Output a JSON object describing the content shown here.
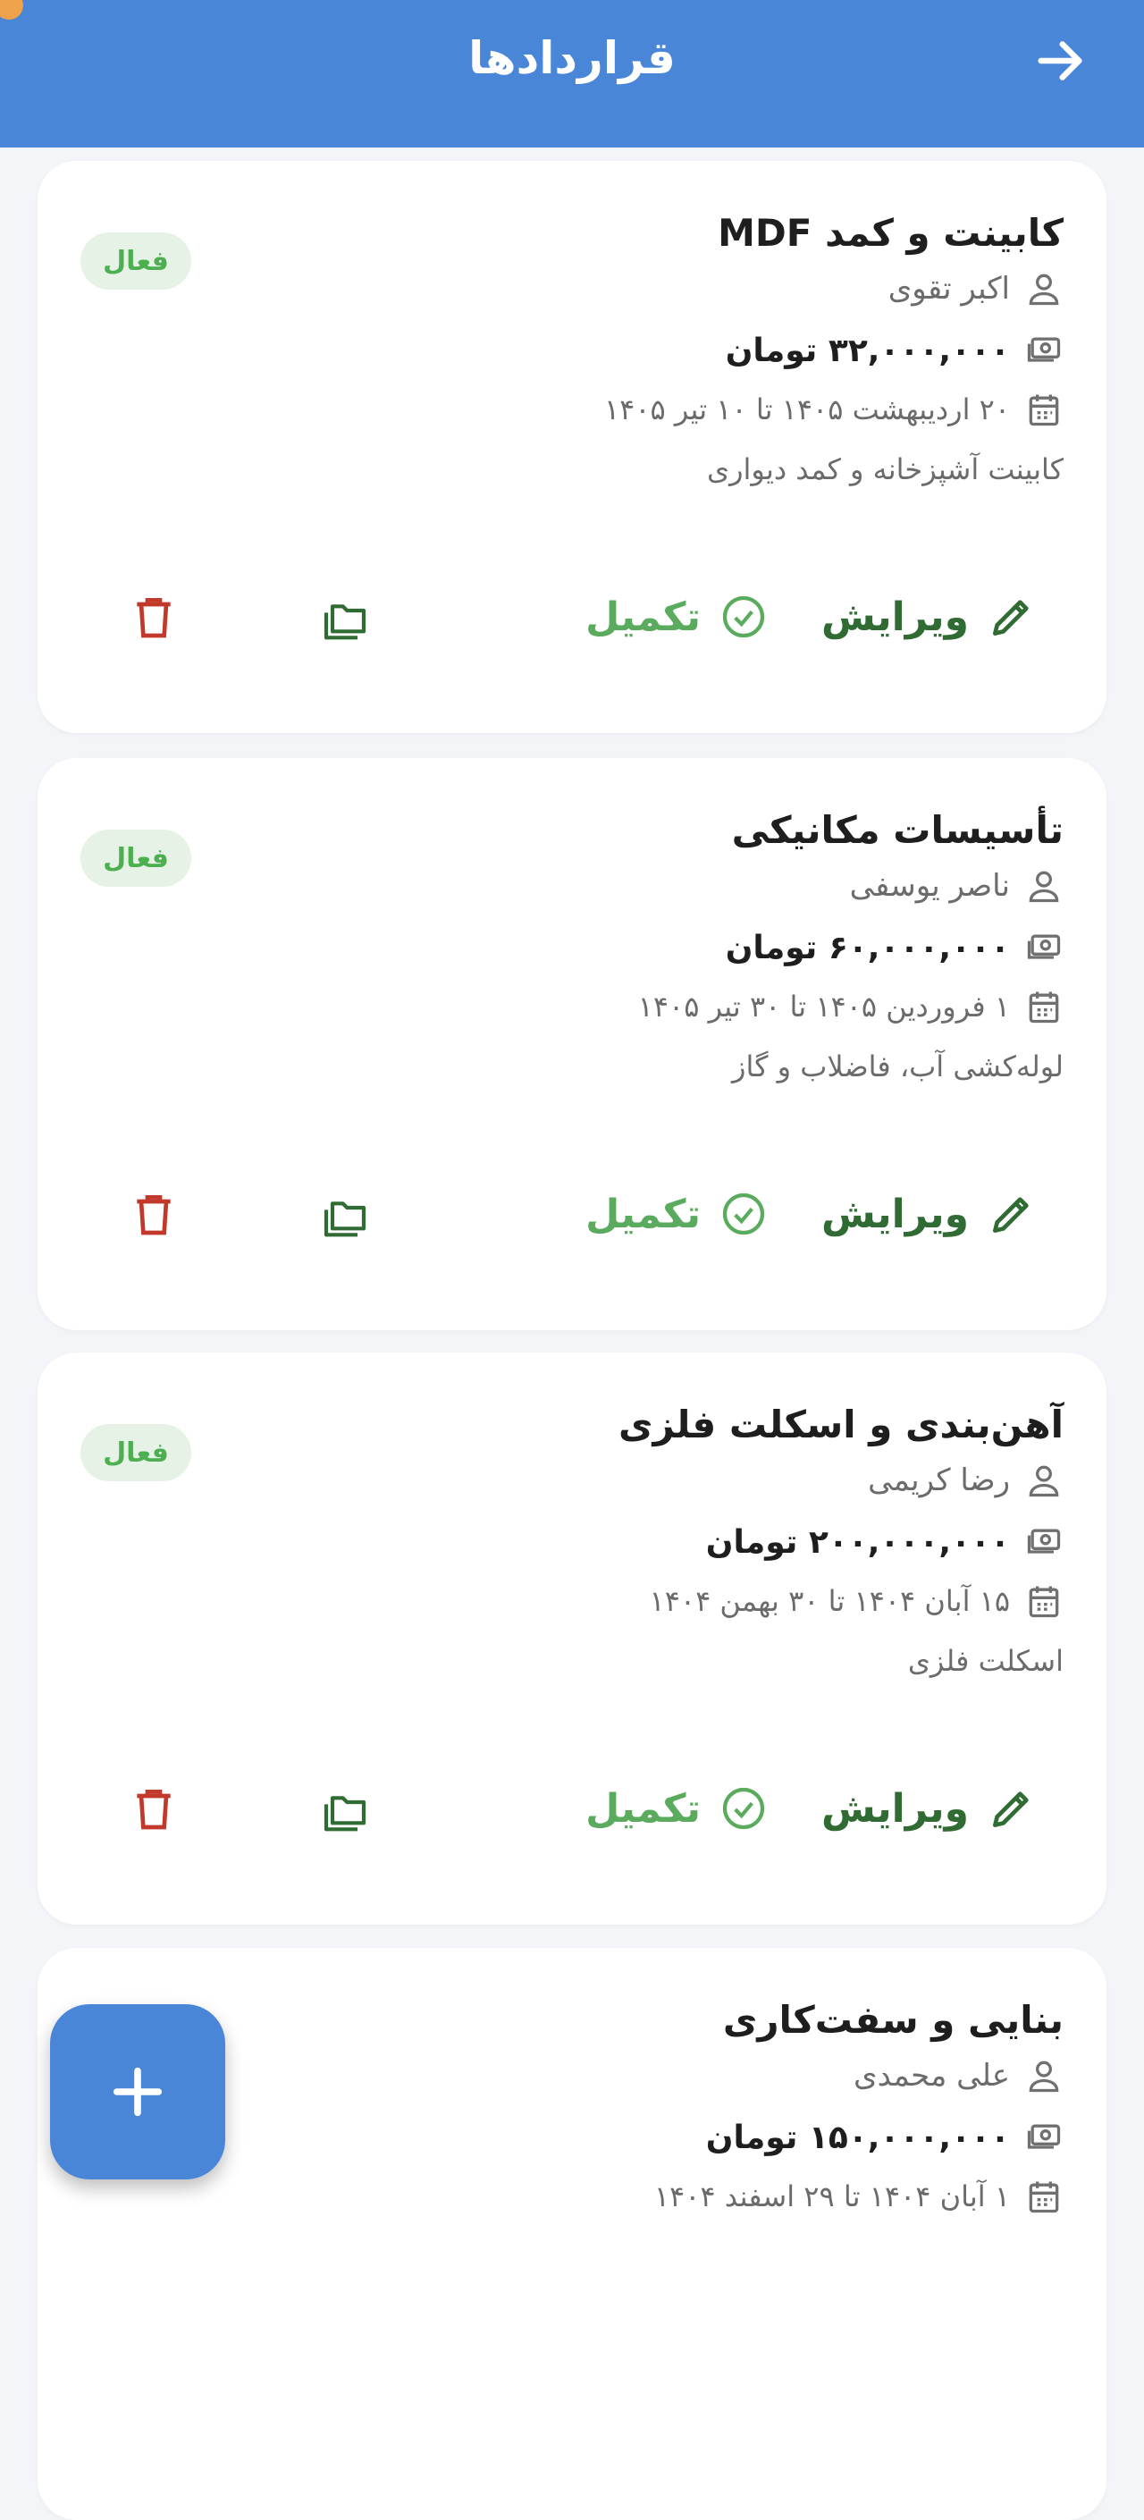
{
  "appbar": {
    "title": "قراردادها",
    "back_icon": "arrow-right-icon",
    "color": "#4a86d8"
  },
  "colors": {
    "status_active": "#4caf50",
    "edit": "#2f6b33",
    "complete": "#5aab5e",
    "delete": "#c0392b"
  },
  "contracts": [
    {
      "title": "کابینت و کمد MDF",
      "contractor": "اکبر تقوی",
      "amount": "۳۲,۰۰۰,۰۰۰ تومان",
      "dates": "۲۰ اردیبهشت ۱۴۰۵ تا ۱۰ تیر ۱۴۰۵",
      "description": "کابینت آشپزخانه و کمد دیواری",
      "status": "فعال",
      "edit_label": "ویرایش",
      "complete_label": "تکمیل"
    },
    {
      "title": "تأسیسات مکانیکی",
      "contractor": "ناصر یوسفی",
      "amount": "۶۰,۰۰۰,۰۰۰ تومان",
      "dates": "۱ فروردین ۱۴۰۵ تا ۳۰ تیر ۱۴۰۵",
      "description": "لوله‌کشی آب، فاضلاب و گاز",
      "status": "فعال",
      "edit_label": "ویرایش",
      "complete_label": "تکمیل"
    },
    {
      "title": "آهن‌بندی و اسکلت فلزی",
      "contractor": "رضا کریمی",
      "amount": "۲۰۰,۰۰۰,۰۰۰ تومان",
      "dates": "۱۵ آبان ۱۴۰۴ تا ۳۰ بهمن ۱۴۰۴",
      "description": "اسکلت فلزی",
      "status": "فعال",
      "edit_label": "ویرایش",
      "complete_label": "تکمیل"
    },
    {
      "title": "بنایی و سفت‌کاری",
      "contractor": "علی محمدی",
      "amount": "۱۵۰,۰۰۰,۰۰۰ تومان",
      "dates": "۱ آبان ۱۴۰۴ تا ۲۹ اسفند ۱۴۰۴"
    }
  ],
  "fab": {
    "icon": "plus-icon"
  }
}
